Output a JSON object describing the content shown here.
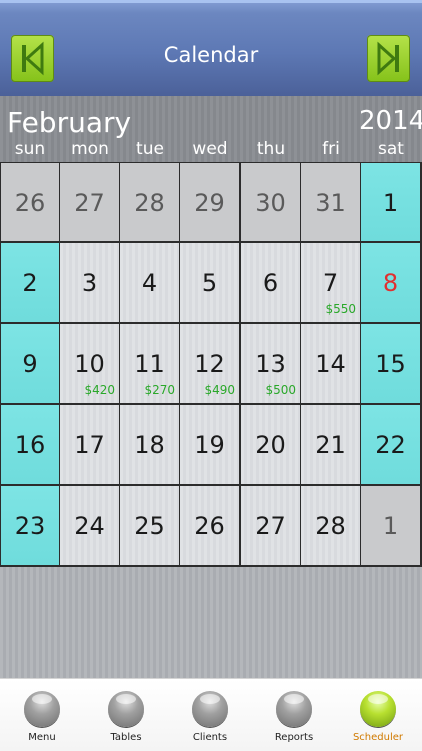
{
  "header": {
    "title": "Calendar",
    "prev_icon": "skip-back-icon",
    "next_icon": "skip-forward-icon",
    "accent": "#9ad033"
  },
  "month": {
    "name": "February",
    "year": "2014"
  },
  "weekdays": [
    "sun",
    "mon",
    "tue",
    "wed",
    "thu",
    "fri",
    "sat"
  ],
  "weeks": [
    [
      {
        "day": "26",
        "type": "outside"
      },
      {
        "day": "27",
        "type": "outside"
      },
      {
        "day": "28",
        "type": "outside"
      },
      {
        "day": "29",
        "type": "outside"
      },
      {
        "day": "30",
        "type": "outside"
      },
      {
        "day": "31",
        "type": "outside"
      },
      {
        "day": "1",
        "type": "weekend"
      }
    ],
    [
      {
        "day": "2",
        "type": "weekend"
      },
      {
        "day": "3",
        "type": "weekday"
      },
      {
        "day": "4",
        "type": "weekday"
      },
      {
        "day": "5",
        "type": "weekday"
      },
      {
        "day": "6",
        "type": "weekday"
      },
      {
        "day": "7",
        "type": "weekday",
        "amount": "$550"
      },
      {
        "day": "8",
        "type": "weekend",
        "today": true
      }
    ],
    [
      {
        "day": "9",
        "type": "weekend"
      },
      {
        "day": "10",
        "type": "weekday",
        "amount": "$420"
      },
      {
        "day": "11",
        "type": "weekday",
        "amount": "$270"
      },
      {
        "day": "12",
        "type": "weekday",
        "amount": "$490"
      },
      {
        "day": "13",
        "type": "weekday",
        "amount": "$500"
      },
      {
        "day": "14",
        "type": "weekday"
      },
      {
        "day": "15",
        "type": "weekend"
      }
    ],
    [
      {
        "day": "16",
        "type": "weekend"
      },
      {
        "day": "17",
        "type": "weekday"
      },
      {
        "day": "18",
        "type": "weekday"
      },
      {
        "day": "19",
        "type": "weekday"
      },
      {
        "day": "20",
        "type": "weekday"
      },
      {
        "day": "21",
        "type": "weekday"
      },
      {
        "day": "22",
        "type": "weekend"
      }
    ],
    [
      {
        "day": "23",
        "type": "weekend"
      },
      {
        "day": "24",
        "type": "weekday"
      },
      {
        "day": "25",
        "type": "weekday"
      },
      {
        "day": "26",
        "type": "weekday"
      },
      {
        "day": "27",
        "type": "weekday"
      },
      {
        "day": "28",
        "type": "weekday"
      },
      {
        "day": "1",
        "type": "outside"
      }
    ]
  ],
  "colors": {
    "weekend": "#6fdcdc",
    "today": "#e03030",
    "amount": "#2aa82a",
    "active_tab": "#d07a00"
  },
  "tabs": [
    {
      "label": "Menu",
      "icon": "menu-ball-icon",
      "active": false
    },
    {
      "label": "Tables",
      "icon": "tables-ball-icon",
      "active": false
    },
    {
      "label": "Clients",
      "icon": "clients-ball-icon",
      "active": false
    },
    {
      "label": "Reports",
      "icon": "reports-ball-icon",
      "active": false
    },
    {
      "label": "Scheduler",
      "icon": "scheduler-ball-icon",
      "active": true
    }
  ]
}
